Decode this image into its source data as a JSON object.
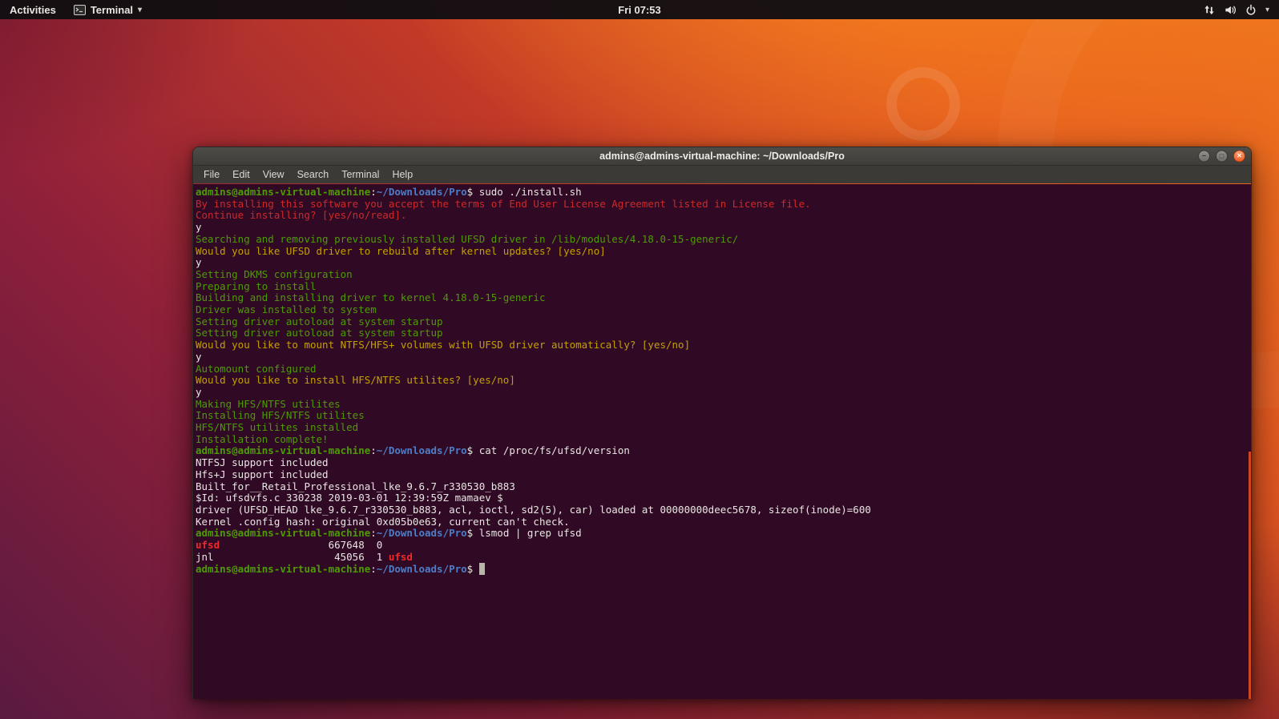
{
  "colors": {
    "accent_orange": "#e95420",
    "terminal_bg": "#300a24",
    "green": "#4e9a06",
    "red": "#cc2a2a",
    "yellow": "#c4a000",
    "white": "#e8e6e3",
    "blue": "#4e7cc6",
    "match_red": "#ef2929",
    "cursor": "#b9b4ac"
  },
  "top_bar": {
    "activities_label": "Activities",
    "app_menu_label": "Terminal",
    "clock": "Fri 07:53",
    "tray_icons": [
      "network-icon",
      "volume-icon",
      "power-icon",
      "chevron-down-icon"
    ]
  },
  "window": {
    "title": "admins@admins-virtual-machine: ~/Downloads/Pro",
    "menu": [
      "File",
      "Edit",
      "View",
      "Search",
      "Terminal",
      "Help"
    ],
    "controls": {
      "minimize": "−",
      "maximize": "□",
      "close": "×"
    }
  },
  "terminal": {
    "lines": [
      [
        {
          "c": "prompt",
          "t": "admins@admins-virtual-machine"
        },
        {
          "c": "plain",
          "t": ":"
        },
        {
          "c": "path",
          "t": "~/Downloads/Pro"
        },
        {
          "c": "plain",
          "t": "$ sudo ./install.sh"
        }
      ],
      [
        {
          "c": "red",
          "t": "By installing this software you accept the terms of End User License Agreement listed in License file."
        }
      ],
      [
        {
          "c": "red",
          "t": "Continue installing? [yes/no/read]."
        }
      ],
      [
        {
          "c": "plain",
          "t": "y"
        }
      ],
      [
        {
          "c": "green",
          "t": "Searching and removing previously installed UFSD driver in /lib/modules/4.18.0-15-generic/"
        }
      ],
      [
        {
          "c": "yellow",
          "t": "Would you like UFSD driver to rebuild after kernel updates? [yes/no]"
        }
      ],
      [
        {
          "c": "plain",
          "t": "y"
        }
      ],
      [
        {
          "c": "green",
          "t": "Setting DKMS configuration"
        }
      ],
      [
        {
          "c": "green",
          "t": "Preparing to install"
        }
      ],
      [
        {
          "c": "green",
          "t": "Building and installing driver to kernel 4.18.0-15-generic"
        }
      ],
      [
        {
          "c": "green",
          "t": "Driver was installed to system"
        }
      ],
      [
        {
          "c": "green",
          "t": "Setting driver autoload at system startup"
        }
      ],
      [
        {
          "c": "green",
          "t": "Setting driver autoload at system startup"
        }
      ],
      [
        {
          "c": "yellow",
          "t": "Would you like to mount NTFS/HFS+ volumes with UFSD driver automatically? [yes/no]"
        }
      ],
      [
        {
          "c": "plain",
          "t": "y"
        }
      ],
      [
        {
          "c": "green",
          "t": "Automount configured"
        }
      ],
      [
        {
          "c": "yellow",
          "t": "Would you like to install HFS/NTFS utilites? [yes/no]"
        }
      ],
      [
        {
          "c": "plain",
          "t": "y"
        }
      ],
      [
        {
          "c": "green",
          "t": "Making HFS/NTFS utilites"
        }
      ],
      [
        {
          "c": "green",
          "t": "Installing HFS/NTFS utilites"
        }
      ],
      [
        {
          "c": "green",
          "t": "HFS/NTFS utilites installed"
        }
      ],
      [
        {
          "c": "green",
          "t": "Installation complete!"
        }
      ],
      [
        {
          "c": "prompt",
          "t": "admins@admins-virtual-machine"
        },
        {
          "c": "plain",
          "t": ":"
        },
        {
          "c": "path",
          "t": "~/Downloads/Pro"
        },
        {
          "c": "plain",
          "t": "$ cat /proc/fs/ufsd/version"
        }
      ],
      [
        {
          "c": "plain",
          "t": "NTFSJ support included"
        }
      ],
      [
        {
          "c": "plain",
          "t": "Hfs+J support included"
        }
      ],
      [
        {
          "c": "plain",
          "t": "Built_for__Retail_Professional_lke_9.6.7_r330530_b883"
        }
      ],
      [
        {
          "c": "plain",
          "t": "$Id: ufsdvfs.c 330238 2019-03-01 12:39:59Z mamaev $"
        }
      ],
      [
        {
          "c": "plain",
          "t": "driver (UFSD_HEAD lke_9.6.7_r330530_b883, acl, ioctl, sd2(5), car) loaded at 00000000deec5678, sizeof(inode)=600"
        }
      ],
      [
        {
          "c": "plain",
          "t": "Kernel .config hash: original 0xd05b0e63, current can't check."
        }
      ],
      [
        {
          "c": "prompt",
          "t": "admins@admins-virtual-machine"
        },
        {
          "c": "plain",
          "t": ":"
        },
        {
          "c": "path",
          "t": "~/Downloads/Pro"
        },
        {
          "c": "plain",
          "t": "$ lsmod | grep ufsd"
        }
      ],
      [
        {
          "c": "match",
          "t": "ufsd"
        },
        {
          "c": "plain",
          "t": "                  667648  0"
        }
      ],
      [
        {
          "c": "plain",
          "t": "jnl                    45056  1 "
        },
        {
          "c": "match",
          "t": "ufsd"
        }
      ],
      [
        {
          "c": "prompt",
          "t": "admins@admins-virtual-machine"
        },
        {
          "c": "plain",
          "t": ":"
        },
        {
          "c": "path",
          "t": "~/Downloads/Pro"
        },
        {
          "c": "plain",
          "t": "$ "
        },
        {
          "c": "cursor",
          "t": " "
        }
      ]
    ]
  }
}
